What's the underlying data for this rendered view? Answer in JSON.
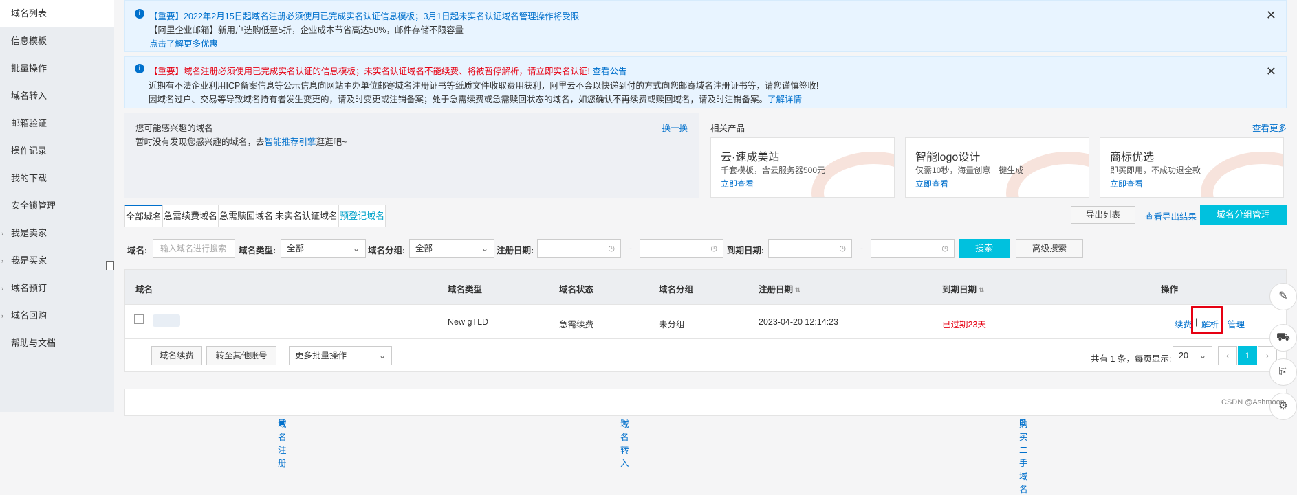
{
  "sidebar": {
    "items": [
      {
        "label": "域名列表"
      },
      {
        "label": "信息模板"
      },
      {
        "label": "批量操作"
      },
      {
        "label": "域名转入"
      },
      {
        "label": "邮箱验证"
      },
      {
        "label": "操作记录"
      },
      {
        "label": "我的下载"
      },
      {
        "label": "安全锁管理"
      },
      {
        "label": "我是卖家"
      },
      {
        "label": "我是买家"
      },
      {
        "label": "域名预订"
      },
      {
        "label": "域名回购"
      },
      {
        "label": "帮助与文档"
      }
    ]
  },
  "notice1": {
    "line1": "【重要】2022年2月15日起域名注册必须使用已完成实名认证信息模板；3月1日起未实名认证域名管理操作将受限",
    "line2": "【阿里企业邮箱】新用户选购低至5折，企业成本节省高达50%，邮件存储不限容量",
    "link": "点击了解更多优惠"
  },
  "notice2": {
    "line1_red": "【重要】域名注册必须使用已完成实名认证的信息模板；未实名认证域名不能续费、将被暂停解析，请立即实名认证!",
    "line1_link": "查看公告",
    "line2": "近期有不法企业利用ICP备案信息等公示信息向网站主办单位邮寄域名注册证书等纸质文件收取费用获利，阿里云不会以快递到付的方式向您邮寄域名注册证书等，请您谨慎签收!",
    "line3": "因域名过户、交易等导致域名持有者发生变更的，请及时变更或注销备案；处于急需续费或急需赎回状态的域名，如您确认不再续费或赎回域名，请及时注销备案。",
    "line3_link": "了解详情"
  },
  "recommend": {
    "title": "您可能感兴趣的域名",
    "text_prefix": "暂时没有发现您感兴趣的域名，去",
    "text_link": "智能推荐引擎",
    "text_suffix": "逛逛吧~",
    "swap": "换一换"
  },
  "related": {
    "title": "相关产品",
    "more": "查看更多",
    "cards": [
      {
        "title": "云·速成美站",
        "desc": "千套模板，含云服务器500元",
        "link": "立即查看"
      },
      {
        "title": "智能logo设计",
        "desc": "仅需10秒，海量创意一键生成",
        "link": "立即查看"
      },
      {
        "title": "商标优选",
        "desc": "即买即用，不成功退全款",
        "link": "立即查看"
      }
    ]
  },
  "tabs": [
    {
      "label": "全部域名"
    },
    {
      "label": "急需续费域名"
    },
    {
      "label": "急需赎回域名"
    },
    {
      "label": "未实名认证域名"
    },
    {
      "label": "预登记域名"
    }
  ],
  "toolbar": {
    "export": "导出列表",
    "view_export": "查看导出结果",
    "group_manage": "域名分组管理"
  },
  "filters": {
    "domain_label": "域名:",
    "domain_placeholder": "输入域名进行搜索",
    "type_label": "域名类型:",
    "type_value": "全部",
    "group_label": "域名分组:",
    "group_value": "全部",
    "reg_label": "注册日期:",
    "exp_label": "到期日期:",
    "search": "搜索",
    "advanced": "高级搜索"
  },
  "table": {
    "headers": {
      "domain": "域名",
      "type": "域名类型",
      "status": "域名状态",
      "group": "域名分组",
      "reg": "注册日期",
      "exp": "到期日期",
      "ops": "操作"
    },
    "rows": [
      {
        "type": "New gTLD",
        "status": "急需续费",
        "group": "未分组",
        "reg": "2023-04-20 12:14:23",
        "exp": "已过期23天",
        "op_renew": "续费",
        "op_sep": "|",
        "op_resolve": "解析",
        "op_manage": "管理"
      }
    ]
  },
  "footer": {
    "renew": "域名续费",
    "transfer": "转至其他账号",
    "batch": "更多批量操作",
    "total": "共有 1 条，每页显示:",
    "page_size": "20",
    "prev": "‹",
    "page": "1",
    "next": "›"
  },
  "bottom_links": {
    "register": "域名注册",
    "transfer_in": "域名转入",
    "buy_second": "购买二手域名"
  },
  "watermark": "CSDN @Ashmoon"
}
